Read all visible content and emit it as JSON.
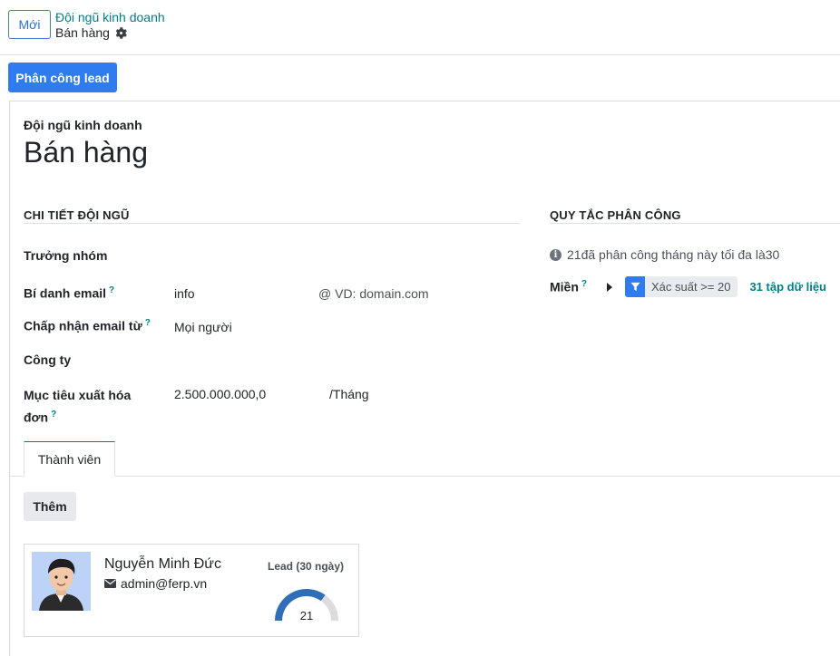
{
  "control_panel": {
    "new_button": "Mới",
    "breadcrumb_parent": "Đội ngũ kinh doanh",
    "breadcrumb_current": "Bán hàng"
  },
  "actions": {
    "assign_leads_button": "Phân công lead"
  },
  "form": {
    "title_label": "Đội ngũ kinh doanh",
    "title": "Bán hàng",
    "team_details": {
      "heading": "CHI TIẾT ĐỘI NGŨ",
      "team_leader_label": "Trưởng nhóm",
      "team_leader_value": "",
      "email_alias_label": "Bí danh email",
      "email_alias_help": "?",
      "email_alias_value": "info",
      "email_domain_placeholder": "@ VD: domain.com",
      "accept_emails_label": "Chấp nhận email từ",
      "accept_emails_help": "?",
      "accept_emails_value": "Mọi người",
      "company_label": "Công ty",
      "company_value": "",
      "invoice_target_label_line1": "Mục tiêu xuất hóa",
      "invoice_target_label_line2": "đơn",
      "invoice_target_help": "?",
      "invoice_target_value": "2.500.000.000,00",
      "invoice_target_unit": "/Tháng"
    },
    "assignment_rules": {
      "heading": "QUY TẮC PHÂN CÔNG",
      "info_text": "21đã phân công tháng này tối đa là30",
      "domain_label": "Miền",
      "domain_help": "?",
      "filter_text": "Xác suất >= 20",
      "records_link": "31 tập dữ liệu"
    },
    "tabs": [
      {
        "label": "Thành viên"
      }
    ],
    "members": {
      "add_button": "Thêm",
      "cards": [
        {
          "name": "Nguyễn Minh Đức",
          "email": "admin@ferp.vn",
          "lead_label": "Lead (30 ngày)",
          "lead_count": "21",
          "lead_fraction": 0.7
        }
      ]
    }
  },
  "colors": {
    "primary": "#2f7bf0",
    "link_teal": "#017e84",
    "gauge_fill": "#2f6fb7",
    "gauge_track": "#dcdcdc"
  }
}
